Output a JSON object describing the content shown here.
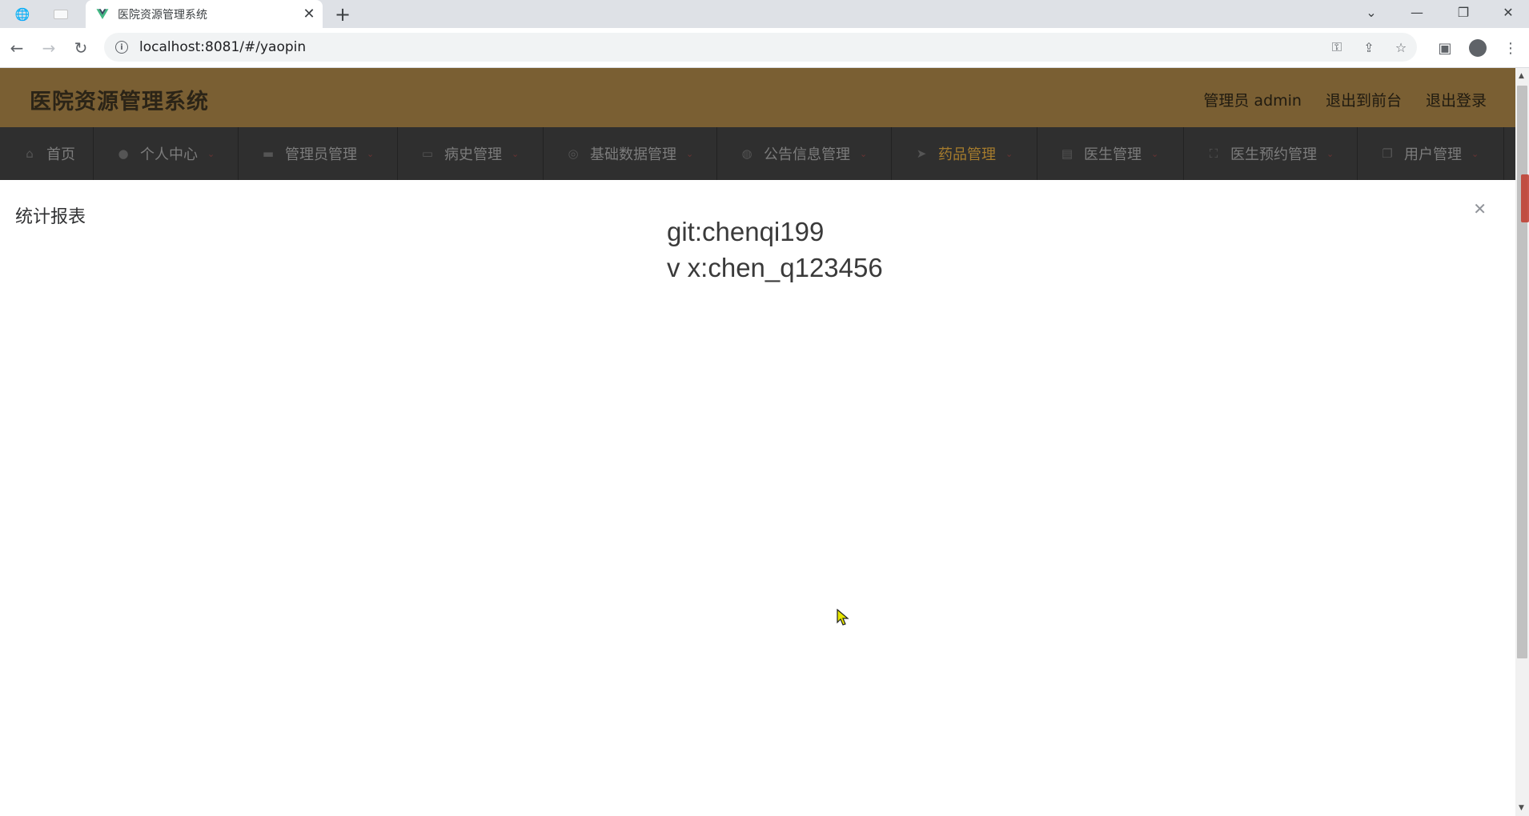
{
  "browser": {
    "tab_title": "医院资源管理系统",
    "url": "localhost:8081/#/yaopin"
  },
  "header": {
    "app_title": "医院资源管理系统",
    "user_label": "管理员 admin",
    "frontend_link": "退出到前台",
    "logout_link": "退出登录"
  },
  "nav": {
    "items": [
      {
        "label": "首页",
        "icon": "home-icon"
      },
      {
        "label": "个人中心",
        "icon": "user-icon"
      },
      {
        "label": "管理员管理",
        "icon": "briefcase-icon"
      },
      {
        "label": "病史管理",
        "icon": "chat-icon"
      },
      {
        "label": "基础数据管理",
        "icon": "info-circle-icon"
      },
      {
        "label": "公告信息管理",
        "icon": "globe-icon"
      },
      {
        "label": "药品管理",
        "icon": "send-icon"
      },
      {
        "label": "医生管理",
        "icon": "clipboard-icon"
      },
      {
        "label": "医生预约管理",
        "icon": "fullscreen-icon"
      },
      {
        "label": "用户管理",
        "icon": "copy-icon"
      }
    ],
    "active_index": 6
  },
  "content": {
    "panel_title": "统计报表",
    "watermark_line1": "git:chenqi199",
    "watermark_line2": "v x:chen_q123456"
  },
  "colors": {
    "header_bg": "#7a5f33",
    "nav_bg": "#2f2f2f",
    "active_nav": "#a67c2d"
  }
}
